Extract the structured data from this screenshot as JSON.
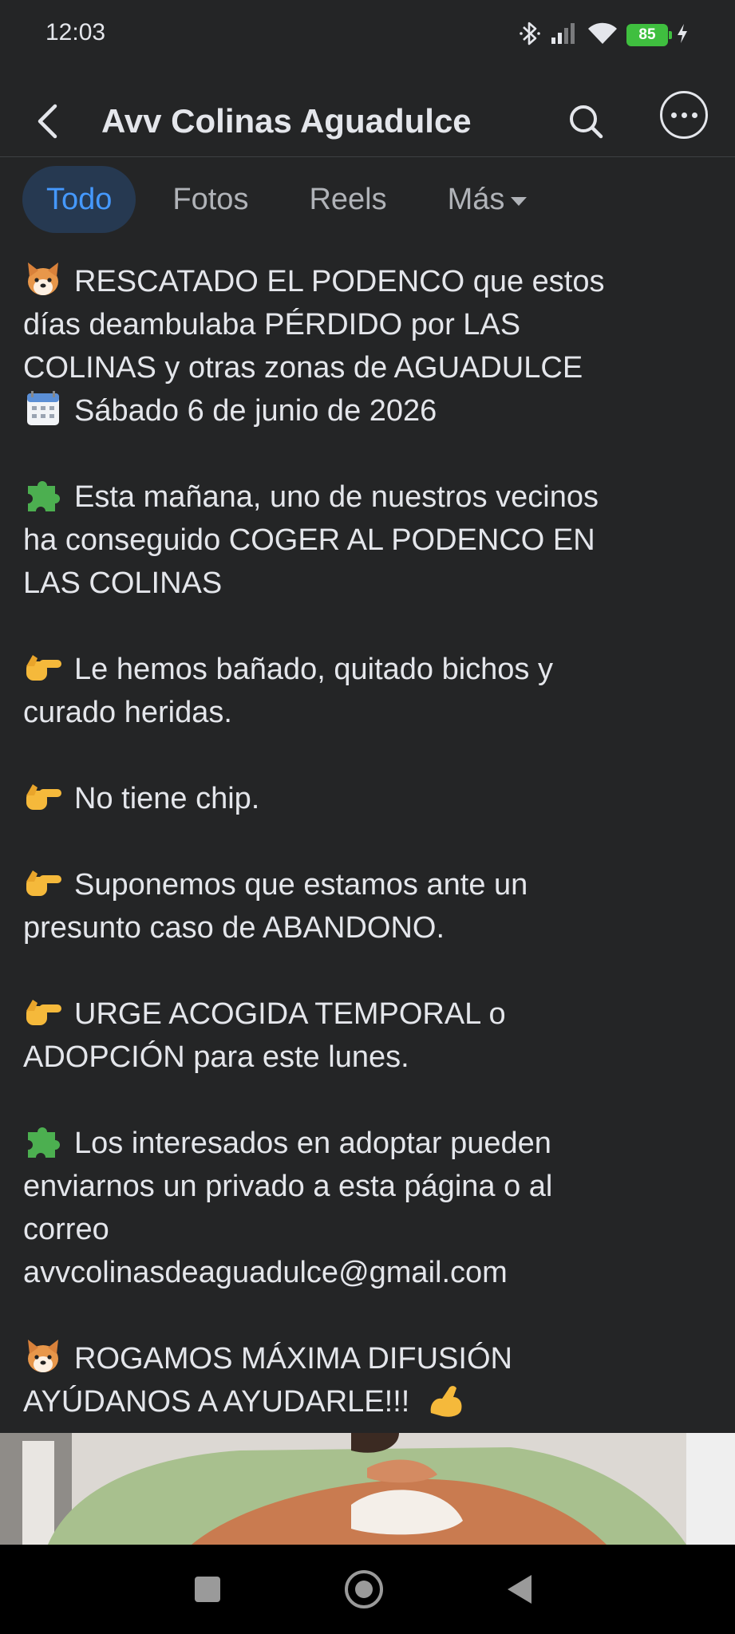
{
  "status_bar": {
    "time": "12:03",
    "battery": "85",
    "icons": [
      "bluetooth-icon",
      "signal-icon",
      "wifi-icon",
      "battery-icon",
      "charging-icon"
    ]
  },
  "header": {
    "title": "Avv Colinas Aguadulce",
    "icons": [
      "back-arrow-icon",
      "search-icon",
      "more-options-icon"
    ]
  },
  "tabs": [
    {
      "label": "Todo",
      "active": true
    },
    {
      "label": "Fotos",
      "active": false
    },
    {
      "label": "Reels",
      "active": false
    },
    {
      "label": "Más",
      "active": false
    }
  ],
  "post": {
    "p1": {
      "emoji": "dog-face-emoji",
      "l1": "RESCATADO EL PODENCO que estos",
      "l2": "días deambulaba PÉRDIDO por LAS",
      "l3": "COLINAS y otras zonas de AGUADULCE",
      "emoji2": "calendar-emoji",
      "l4": "Sábado 6 de junio de 2026"
    },
    "p2": {
      "emoji": "puzzle-piece-emoji",
      "l1": "Esta mañana, uno de nuestros vecinos",
      "l2": "ha conseguido COGER AL PODENCO EN",
      "l3": "LAS COLINAS"
    },
    "p3": {
      "emoji": "pointing-right-emoji",
      "l1": "Le hemos bañado, quitado bichos y",
      "l2": "curado heridas."
    },
    "p4": {
      "emoji": "pointing-right-emoji",
      "l1": "No tiene chip."
    },
    "p5": {
      "emoji": "pointing-right-emoji",
      "l1": "Suponemos que estamos ante un",
      "l2": "presunto caso de ABANDONO."
    },
    "p6": {
      "emoji": "pointing-right-emoji",
      "l1": "URGE ACOGIDA TEMPORAL o",
      "l2": "ADOPCIÓN para este lunes."
    },
    "p7": {
      "emoji": "puzzle-piece-emoji",
      "l1": "Los interesados en adoptar pueden",
      "l2": "enviarnos un privado a esta página o al",
      "l3": "correo",
      "l4": "avvcolinasdeaguadulce@gmail.com"
    },
    "p8": {
      "emoji": "dog-face-emoji",
      "l1": "ROGAMOS MÁXIMA DIFUSIÓN",
      "l2": "AYÚDANOS A AYUDARLE!!!",
      "emoji2": "flexed-biceps-emoji"
    }
  },
  "nav_bar": {
    "icons": [
      "recents-square-icon",
      "home-circle-icon",
      "back-triangle-icon"
    ]
  },
  "colors": {
    "background": "#242526",
    "text": "#e4e6eb",
    "active_tab_bg": "#263951",
    "active_tab_text": "#4599ff",
    "inactive_tab_text": "#b0b3b8",
    "battery": "#3fbf3f"
  }
}
